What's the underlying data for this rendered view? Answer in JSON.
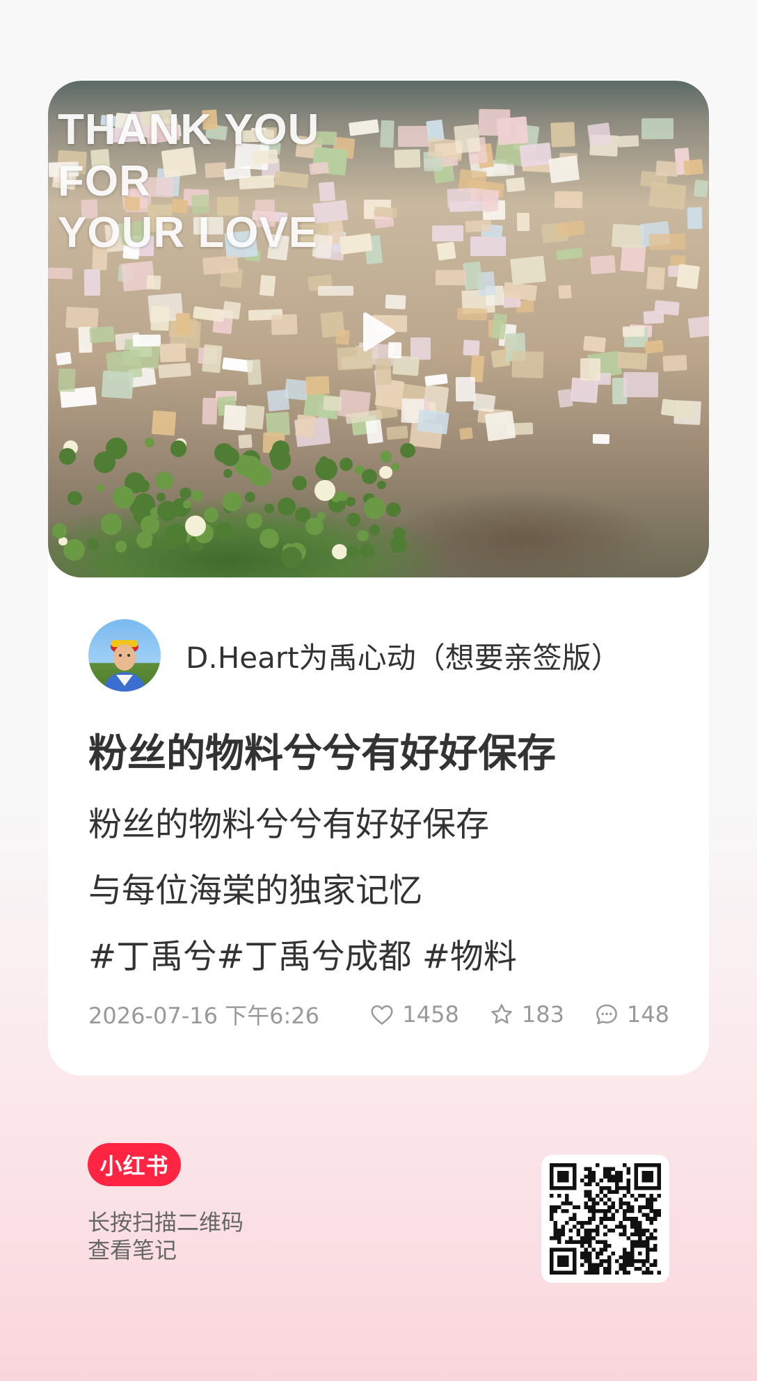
{
  "cover": {
    "overlay_text_lines": [
      "THANK YOU",
      "FOR",
      "YOUR LOVE"
    ],
    "has_play_icon": true
  },
  "author": {
    "name": "D.Heart为禹心动（想要亲签版）"
  },
  "note": {
    "title": "粉丝的物料兮兮有好好保存",
    "body_lines": [
      "粉丝的物料兮兮有好好保存",
      "与每位海棠的独家记忆",
      "#丁禹兮#丁禹兮成都 #物料"
    ],
    "timestamp": "2026-07-16 下午6:26",
    "likes": "1458",
    "collects": "183",
    "comments": "148"
  },
  "brand": {
    "logo_text": "小红书",
    "hint_lines": [
      "长按扫描二维码",
      "查看笔记"
    ]
  },
  "colors": {
    "brand_red": "#ff2442",
    "meta_gray": "#999999",
    "text_dark": "#333333"
  },
  "icons": [
    "play-icon",
    "heart-icon",
    "star-icon",
    "comment-icon",
    "qr-code"
  ]
}
